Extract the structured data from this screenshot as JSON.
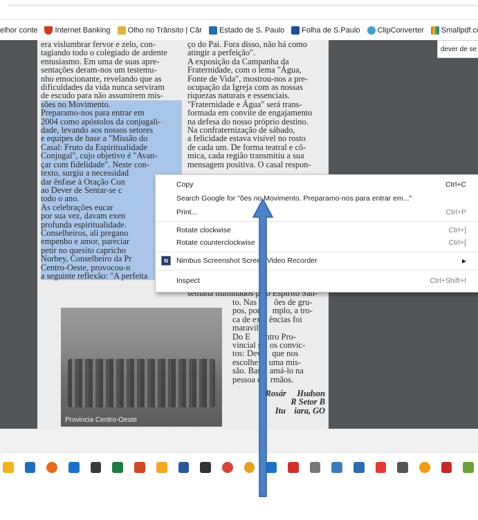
{
  "bookmarks": {
    "truncated": "elhor conte",
    "items": [
      {
        "label": "Internet Banking",
        "icon": "bank-icon",
        "color": "#d63b1f"
      },
      {
        "label": "Olho no Trânsito | Câr",
        "icon": "lock-icon",
        "color": "#e2b23a"
      },
      {
        "label": "Estado de S. Paulo",
        "icon": "estadao-icon",
        "color": "#1e6fb8"
      },
      {
        "label": "Folha de S.Paulo",
        "icon": "folha-icon",
        "color": "#1f4f9a"
      },
      {
        "label": "ClipConverter",
        "icon": "clipconverter-icon",
        "color": "#3d9fcf"
      },
      {
        "label": "Smallpdf.com - A Fr",
        "icon": "smallpdf-icon",
        "color": "#e4572e"
      }
    ]
  },
  "tooltip": {
    "text": "dever de se"
  },
  "document": {
    "col1": [
      {
        "text": "era vislumbrar fervor e zelo, con-",
        "hl": false
      },
      {
        "text": "tagiando todo o colegiado de ardente",
        "hl": false
      },
      {
        "text": "entusiasmo. Em uma de suas apre-",
        "hl": false
      },
      {
        "text": "sentações deram-nos um testemu-",
        "hl": false
      },
      {
        "text": "nho emocionante, revelando que as",
        "hl": false
      },
      {
        "text": "dificuldades da vida nunca serviram",
        "hl": false
      },
      {
        "text": "de escudo para não assumirem mis-",
        "hl": false
      },
      {
        "text": "sões no Movimento.",
        "hl": true
      },
      {
        "text": "Preparamo-nos para entrar em",
        "hl": true
      },
      {
        "text": "2004 como apóstolos da conjugali-",
        "hl": true
      },
      {
        "text": "dade, levando aos nossos setores",
        "hl": true
      },
      {
        "text": "e equipes de base a \"Missão do",
        "hl": true
      },
      {
        "text": "Casal: Fruto da Espiritualidade",
        "hl": true
      },
      {
        "text": "Conjugal\", cujo objetivo é \"Avan-",
        "hl": true
      },
      {
        "text": "çar com fidelidade\". Neste con-",
        "hl": true
      },
      {
        "text": "texto, surgiu a necessidad",
        "hl": true
      },
      {
        "text": "dar ênfase à Oração Con",
        "hl": true
      },
      {
        "text": "ao Dever de Sentar-se c",
        "hl": true
      },
      {
        "text": "todo o ano.",
        "hl": true
      },
      {
        "text": "As celebrações eucar",
        "hl": true
      },
      {
        "text": "por sua vez, davam exen",
        "hl": true
      },
      {
        "text": "profunda espiritualidade.",
        "hl": true
      },
      {
        "text": "Conselheiros, ali pregano",
        "hl": true
      },
      {
        "text": "empenho e amor, pareciar",
        "hl": true
      },
      {
        "text": "petir no quesito capricho",
        "hl": true
      },
      {
        "text": "Norbey, Conselheiro da Pr",
        "hl": true
      },
      {
        "text": "Centro-Oeste, provocou-n",
        "hl": true
      },
      {
        "text": "a seguinte reflexão: \"A perfeita",
        "hl": true
      }
    ],
    "col2": [
      {
        "text": "ço do Pai. Fora disso, não há como",
        "hl": false
      },
      {
        "text": "atingir a perfeição\".",
        "hl": false
      },
      {
        "text": "A exposição da Campanha da",
        "hl": false
      },
      {
        "text": "Fraternidade, com o lema \"Água,",
        "hl": false
      },
      {
        "text": "Fonte de Vida\", mostrou-nos a pre-",
        "hl": false
      },
      {
        "text": "ocupação da Igreja com as nossas",
        "hl": false
      },
      {
        "text": "riquezas naturais e essenciais.",
        "hl": false
      },
      {
        "text": "\"Fraternidade e Água\" será trans-",
        "hl": false
      },
      {
        "text": "formada em convite de engajamento",
        "hl": false
      },
      {
        "text": "na defesa do nosso próprio destino.",
        "hl": false
      },
      {
        "text": "Na confraternização de sábado,",
        "hl": false
      },
      {
        "text": "a felicidade estava visível no rosto",
        "hl": false
      },
      {
        "text": "de cada um. De forma teatral e cô-",
        "hl": false
      },
      {
        "text": "mica, cada região transmitiu a sua",
        "hl": false
      },
      {
        "text": "mensagem positiva. O casal respon-",
        "hl": false
      }
    ],
    "col2_tail": "semana iluminados pelo Espírito San-",
    "col3": [
      "to. Nas re    ões de gru-",
      "pos, por e   mplo, a tro-",
      "ca de ex    ências foi",
      "maravilh",
      "Do E     ontro Pro-",
      "vincial s    os convic-",
      "tos: Dev     que nos",
      "escolhe     uma mis-",
      "são. Bas    amá-lo na",
      "pessoa d    rmãos."
    ],
    "signature": [
      "Rosár     Hudson",
      "R Setor B",
      "Itu    iara, GO"
    ],
    "photo_caption": "Provincia Centro-Oeste"
  },
  "context_menu": {
    "items": [
      {
        "label": "Copy",
        "shortcut": "Ctrl+C",
        "name": "menu-item-copy"
      },
      {
        "label": "Search Google for \"ões no Movimento.  Preparamo-nos para entrar em...\"",
        "shortcut": "",
        "name": "menu-item-search-google"
      },
      {
        "label": "Print...",
        "shortcut": "Ctrl+P",
        "name": "menu-item-print"
      },
      {
        "label": "Rotate clockwise",
        "shortcut": "Ctrl+]",
        "name": "menu-item-rotate-clockwise"
      },
      {
        "label": "Rotate counterclockwise",
        "shortcut": "Ctrl+[",
        "name": "menu-item-rotate-counterclockwise"
      },
      {
        "label": "Nimbus Screenshot  Screen Video Recorder",
        "shortcut": "",
        "name": "menu-item-nimbus"
      },
      {
        "label": "Inspect",
        "shortcut": "Ctrl+Shift+I",
        "name": "menu-item-inspect"
      }
    ],
    "nimbus_glyph": "N"
  },
  "taskbar": {
    "icons": [
      {
        "name": "file-explorer-icon",
        "color": "#f2b41c"
      },
      {
        "name": "store-icon",
        "color": "#1f6fb8"
      },
      {
        "name": "firefox-icon",
        "color": "#e66a1f"
      },
      {
        "name": "outlook-icon",
        "color": "#1a73c9"
      },
      {
        "name": "photoshop-elements-icon",
        "color": "#3a3a3a"
      },
      {
        "name": "excel-icon",
        "color": "#1f7a44"
      },
      {
        "name": "powerpoint-icon",
        "color": "#d24726"
      },
      {
        "name": "messenger-icon",
        "color": "#f5a623"
      },
      {
        "name": "word-icon",
        "color": "#2b579a"
      },
      {
        "name": "7zip-icon",
        "color": "#333333"
      },
      {
        "name": "chrome-icon",
        "color": "#db4437"
      },
      {
        "name": "chrome-icon-2",
        "color": "#e6a21f"
      },
      {
        "name": "search-icon",
        "color": "#1a73c9"
      },
      {
        "name": "shield-icon",
        "color": "#d32f2f"
      },
      {
        "name": "network-icon",
        "color": "#777777"
      },
      {
        "name": "people-icon",
        "color": "#3e7bbd"
      },
      {
        "name": "camera-icon",
        "color": "#2b6cb0"
      },
      {
        "name": "app-red-icon",
        "color": "#e53935"
      },
      {
        "name": "battery-icon",
        "color": "#555555"
      },
      {
        "name": "orange-app-icon",
        "color": "#f39c12"
      },
      {
        "name": "pdf-icon",
        "color": "#c62828"
      },
      {
        "name": "tray-icon",
        "color": "#6d9f3b"
      }
    ]
  }
}
